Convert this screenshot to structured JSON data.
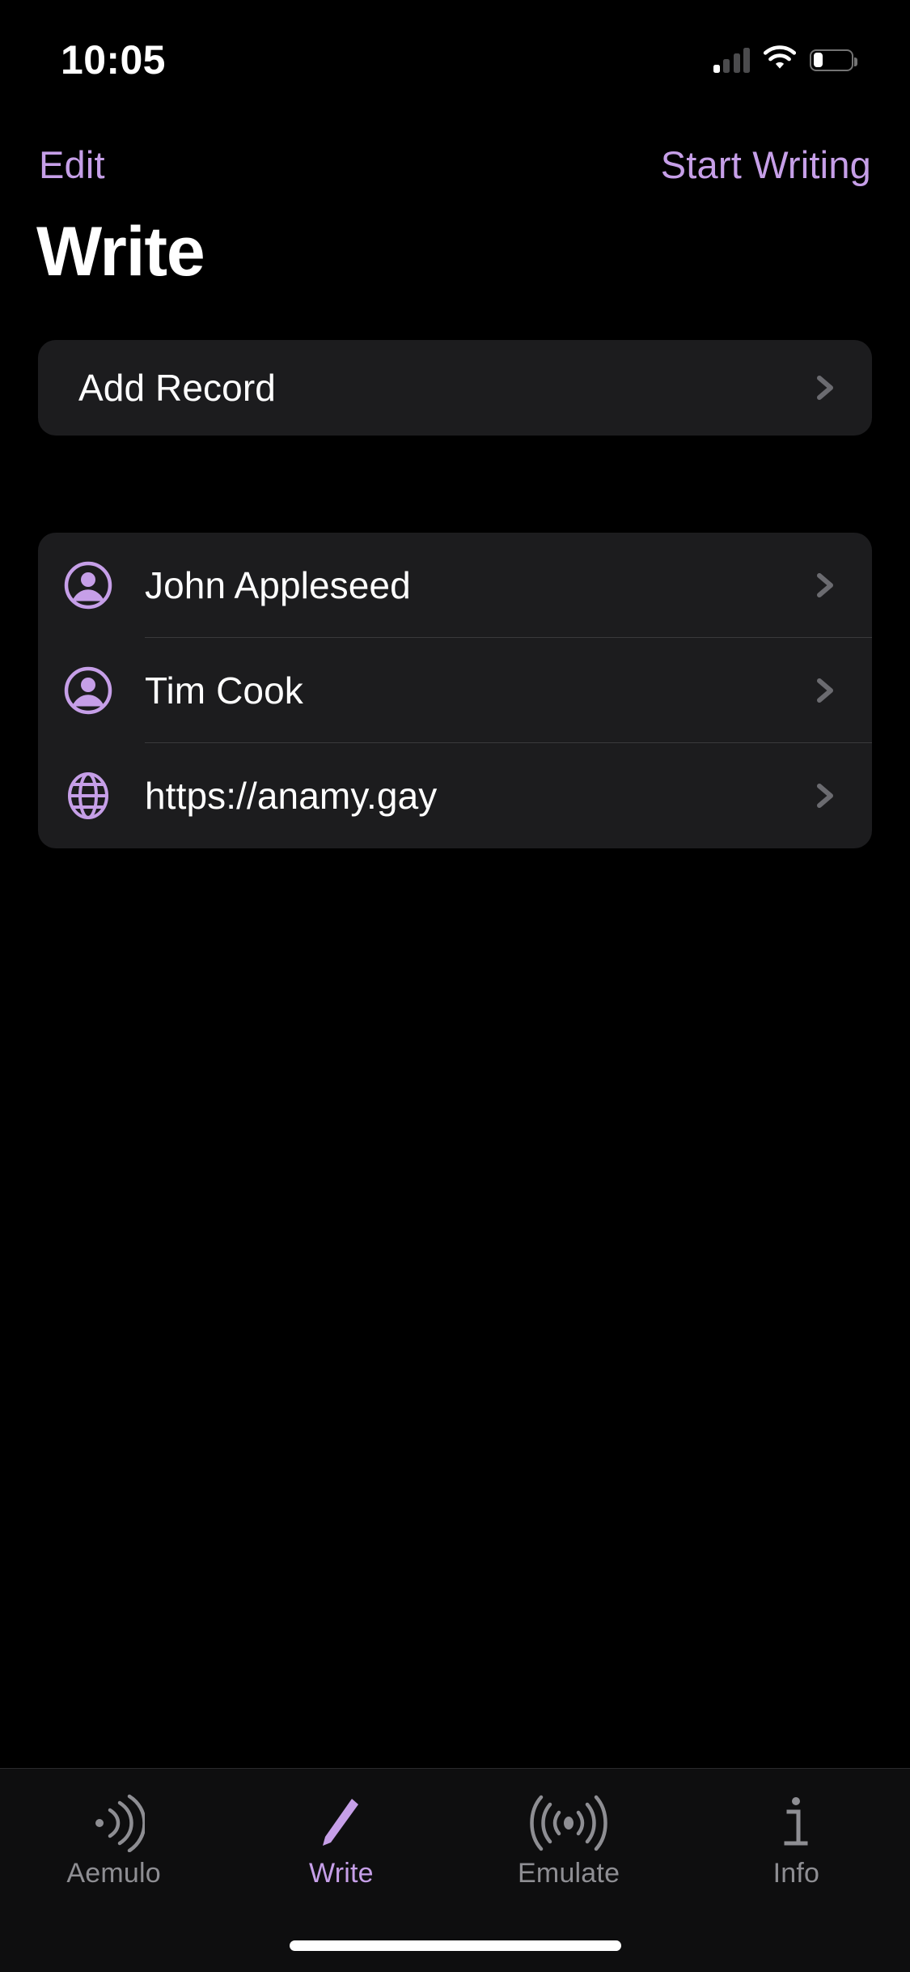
{
  "status_bar": {
    "time": "10:05",
    "cellular_icon": "cellular-signal-icon",
    "cellular_bars_filled": 1,
    "cellular_bars_total": 4,
    "wifi_icon": "wifi-icon",
    "battery_icon": "battery-low-icon",
    "battery_level_percent": 26
  },
  "nav_bar": {
    "left_button": "Edit",
    "right_button": "Start Writing",
    "accent_color": "#C69FE8"
  },
  "page_title": "Write",
  "add_section": {
    "rows": [
      {
        "label": "Add Record",
        "icon": "",
        "accessory": "chevron-right-icon"
      }
    ]
  },
  "records_section": {
    "rows": [
      {
        "label": "John Appleseed",
        "icon": "person-circle-icon",
        "accessory": "chevron-right-icon"
      },
      {
        "label": "Tim Cook",
        "icon": "person-circle-icon",
        "accessory": "chevron-right-icon"
      },
      {
        "label": "https://anamy.gay",
        "icon": "globe-icon",
        "accessory": "chevron-right-icon"
      }
    ]
  },
  "tab_bar": {
    "active_index": 1,
    "active_color": "#C69FE8",
    "inactive_color": "#8E8E93",
    "tabs": [
      {
        "label": "Aemulo",
        "icon": "nfc-wave-icon"
      },
      {
        "label": "Write",
        "icon": "pencil-icon"
      },
      {
        "label": "Emulate",
        "icon": "nfc-broadcast-icon"
      },
      {
        "label": "Info",
        "icon": "info-icon"
      }
    ]
  },
  "colors": {
    "background": "#000000",
    "card_background": "#1C1C1E",
    "separator": "#3A3A3C",
    "chevron": "#6B6B70",
    "text_primary": "#FFFFFF",
    "tabbar_background": "#0E0E0F"
  }
}
